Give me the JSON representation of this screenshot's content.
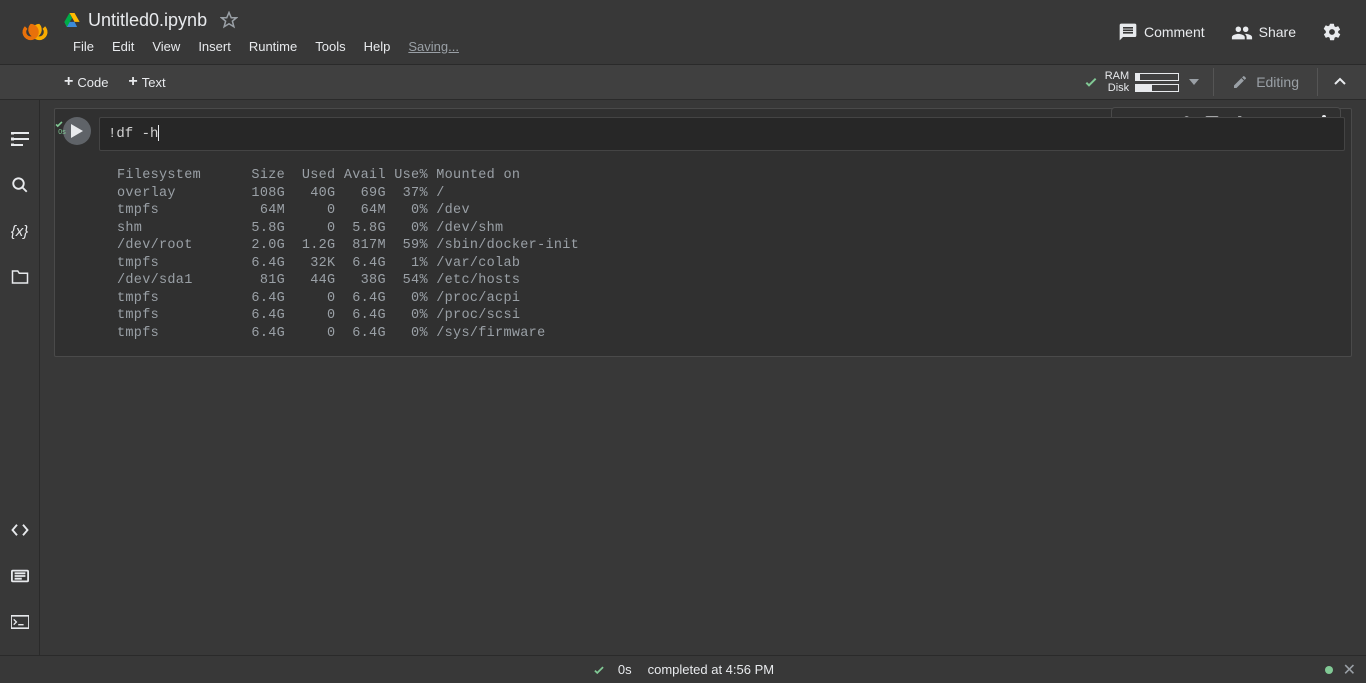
{
  "header": {
    "doc_title": "Untitled0.ipynb",
    "menus": [
      "File",
      "Edit",
      "View",
      "Insert",
      "Runtime",
      "Tools",
      "Help"
    ],
    "saving_label": "Saving...",
    "comment_label": "Comment",
    "share_label": "Share"
  },
  "toolbar": {
    "code_label": "Code",
    "text_label": "Text",
    "resources": {
      "ram_label": "RAM",
      "disk_label": "Disk",
      "ram_pct": 8,
      "disk_pct": 37
    },
    "editing_label": "Editing"
  },
  "cell": {
    "exec_time_label": "0s",
    "code": "!df -h",
    "output": "Filesystem      Size  Used Avail Use% Mounted on\noverlay         108G   40G   69G  37% /\ntmpfs            64M     0   64M   0% /dev\nshm             5.8G     0  5.8G   0% /dev/shm\n/dev/root       2.0G  1.2G  817M  59% /sbin/docker-init\ntmpfs           6.4G   32K  6.4G   1% /var/colab\n/dev/sda1        81G   44G   38G  54% /etc/hosts\ntmpfs           6.4G     0  6.4G   0% /proc/acpi\ntmpfs           6.4G     0  6.4G   0% /proc/scsi\ntmpfs           6.4G     0  6.4G   0% /sys/firmware"
  },
  "status": {
    "duration": "0s",
    "completed_label": "completed at 4:56 PM"
  }
}
